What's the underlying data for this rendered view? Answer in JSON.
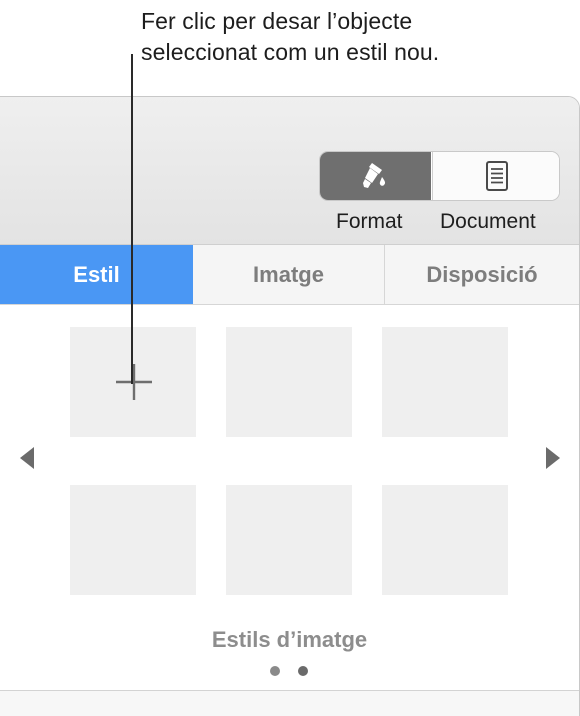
{
  "callout": {
    "line1": "Fer clic per desar l’objecte",
    "line2": "seleccionat com un estil nou."
  },
  "toolbar": {
    "format_label": "Format",
    "document_label": "Document",
    "format_icon": "paintbrush-icon",
    "document_icon": "document-icon",
    "selected": "Format"
  },
  "tabs": [
    {
      "label": "Estil",
      "selected": true
    },
    {
      "label": "Imatge",
      "selected": false
    },
    {
      "label": "Disposició",
      "selected": false
    }
  ],
  "styles": {
    "label": "Estils d’imatge",
    "add_icon": "plus-icon",
    "page_count": 2,
    "current_page": 1
  },
  "colors": {
    "accent": "#4a97f4",
    "selected_segment": "#6f6f6f",
    "thumbnail": "#efefef"
  }
}
